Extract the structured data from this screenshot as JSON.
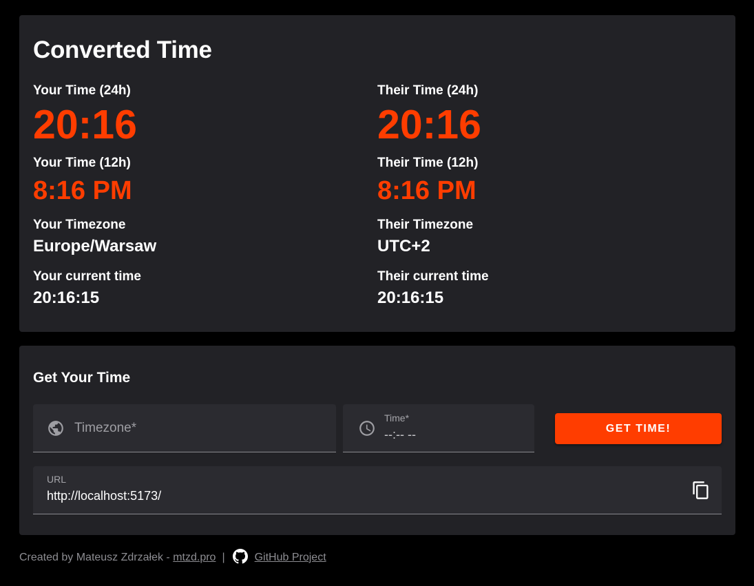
{
  "converted": {
    "title": "Converted Time",
    "left": {
      "time24_label": "Your Time (24h)",
      "time24": "20:16",
      "time12_label": "Your Time (12h)",
      "time12": "8:16 PM",
      "tz_label": "Your Timezone",
      "tz": "Europe/Warsaw",
      "current_label": "Your current time",
      "current": "20:16:15"
    },
    "right": {
      "time24_label": "Their Time (24h)",
      "time24": "20:16",
      "time12_label": "Their Time (12h)",
      "time12": "8:16 PM",
      "tz_label": "Their Timezone",
      "tz": "UTC+2",
      "current_label": "Their current time",
      "current": "20:16:15"
    }
  },
  "form": {
    "title": "Get Your Time",
    "timezone": {
      "placeholder": "Timezone*",
      "icon": "globe-icon"
    },
    "time": {
      "label": "Time*",
      "value": "--:-- --",
      "icon": "clock-icon"
    },
    "button_label": "GET TIME!",
    "url": {
      "label": "URL",
      "value": "http://localhost:5173/",
      "icon": "copy-icon"
    }
  },
  "footer": {
    "prefix": "Created by Mateusz Zdrzałek - ",
    "site_link": "mtzd.pro",
    "separator": "|",
    "github_icon": "github-icon",
    "github_link": "GitHub Project"
  },
  "colors": {
    "accent": "#ff3d00",
    "card_bg": "#222226",
    "page_bg": "#000000",
    "field_bg": "#2b2b30"
  }
}
